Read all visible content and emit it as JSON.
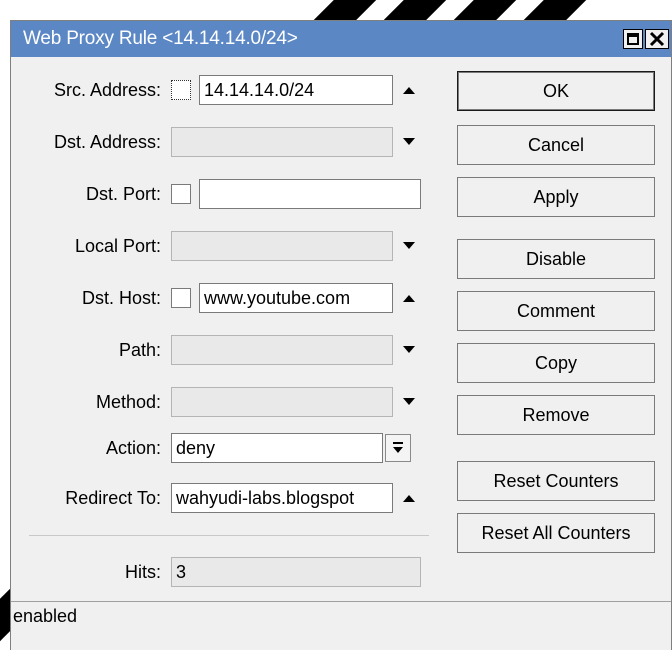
{
  "window": {
    "title": "Web Proxy Rule <14.14.14.0/24>"
  },
  "form": {
    "src_address": {
      "label": "Src. Address:",
      "value": "14.14.14.0/24"
    },
    "dst_address": {
      "label": "Dst. Address:",
      "value": ""
    },
    "dst_port": {
      "label": "Dst. Port:",
      "value": ""
    },
    "local_port": {
      "label": "Local Port:",
      "value": ""
    },
    "dst_host": {
      "label": "Dst. Host:",
      "value": "www.youtube.com"
    },
    "path": {
      "label": "Path:",
      "value": ""
    },
    "method": {
      "label": "Method:",
      "value": ""
    },
    "action": {
      "label": "Action:",
      "value": "deny"
    },
    "redirect_to": {
      "label": "Redirect To:",
      "value": "wahyudi-labs.blogspot"
    },
    "hits": {
      "label": "Hits:",
      "value": "3"
    }
  },
  "buttons": {
    "ok": "OK",
    "cancel": "Cancel",
    "apply": "Apply",
    "disable": "Disable",
    "comment": "Comment",
    "copy": "Copy",
    "remove": "Remove",
    "reset_counters": "Reset Counters",
    "reset_all_counters": "Reset All Counters"
  },
  "status": {
    "text": "enabled"
  },
  "colors": {
    "titlebar": "#5b87c5",
    "background": "#f0f0f0"
  }
}
